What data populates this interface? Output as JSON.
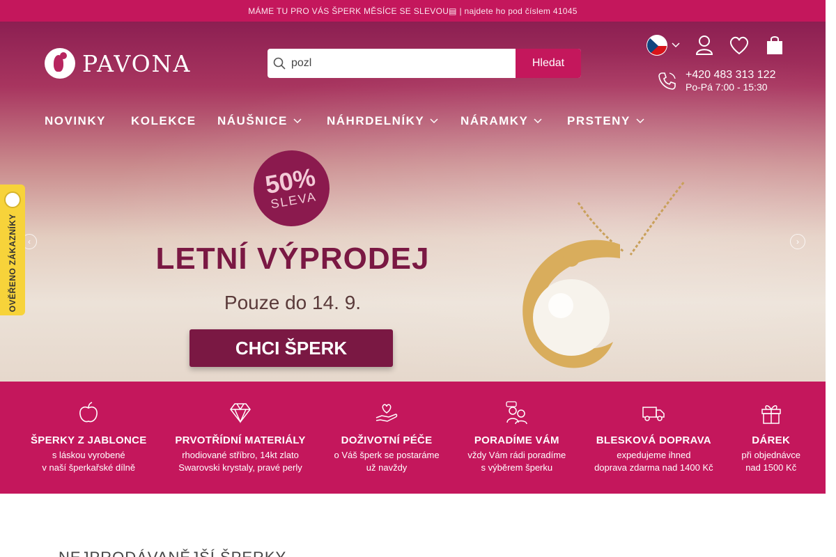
{
  "promo": {
    "text": "MÁME TU PRO VÁS ŠPERK MĚSÍCE SE SLEVOU▤ | najdete ho pod číslem 41045"
  },
  "header": {
    "logo_text": "PAVONA",
    "search": {
      "value": "pozl",
      "button": "Hledat"
    },
    "phone": {
      "number": "+420 483 313 122",
      "hours": "Po-Pá 7:00 - 15:30"
    },
    "icons": [
      "czech-flag",
      "user-icon",
      "heart-icon",
      "shopping-bag-icon"
    ]
  },
  "nav": {
    "items": [
      {
        "label": "NOVINKY"
      },
      {
        "label": "KOLEKCE"
      },
      {
        "label": "NÁUŠNICE"
      },
      {
        "label": "NÁHRDELNÍKY"
      },
      {
        "label": "NÁRAMKY"
      },
      {
        "label": "PRSTENY"
      }
    ]
  },
  "banner": {
    "sale_percent": "50%",
    "sale_word": "SLEVA",
    "title": "LETNÍ VÝPRODEJ",
    "subtitle": "Pouze do 14. 9.",
    "cta": "CHCI ŠPERK",
    "slides_total": 5,
    "active_slide": 1
  },
  "verified": {
    "label": "OVĚŘENO ZÁKAZNÍKY"
  },
  "features": [
    {
      "icon": "apple-icon",
      "title": "ŠPERKY Z JABLONCE",
      "line1": "s láskou vyrobené",
      "line2": "v naší šperkařské dílně"
    },
    {
      "icon": "diamond-icon",
      "title": "PRVOTŘÍDNÍ MATERIÁLY",
      "line1": "rhodiované stříbro, 14kt zlato",
      "line2": "Swarovski krystaly, pravé perly"
    },
    {
      "icon": "hand-heart-icon",
      "title": "DOŽIVOTNÍ PÉČE",
      "line1": "o Váš šperk se postaráme",
      "line2": "už navždy"
    },
    {
      "icon": "advisor-icon",
      "title": "PORADÍME VÁM",
      "line1": "vždy Vám rádi poradíme",
      "line2": "s výběrem šperku"
    },
    {
      "icon": "truck-icon",
      "title": "BLESKOVÁ DOPRAVA",
      "line1": "expedujeme ihned",
      "line2": "doprava zdarma nad 1400 Kč"
    },
    {
      "icon": "gift-icon",
      "title": "DÁREK",
      "line1": "při objednávce",
      "line2": "nad 1500 Kč"
    }
  ],
  "section": {
    "title": "NEJPRODÁVANĚJŠÍ ŠPERKY"
  },
  "colors": {
    "brand": "#c4175c",
    "dark_brand": "#7a1843",
    "white": "#ffffff"
  }
}
